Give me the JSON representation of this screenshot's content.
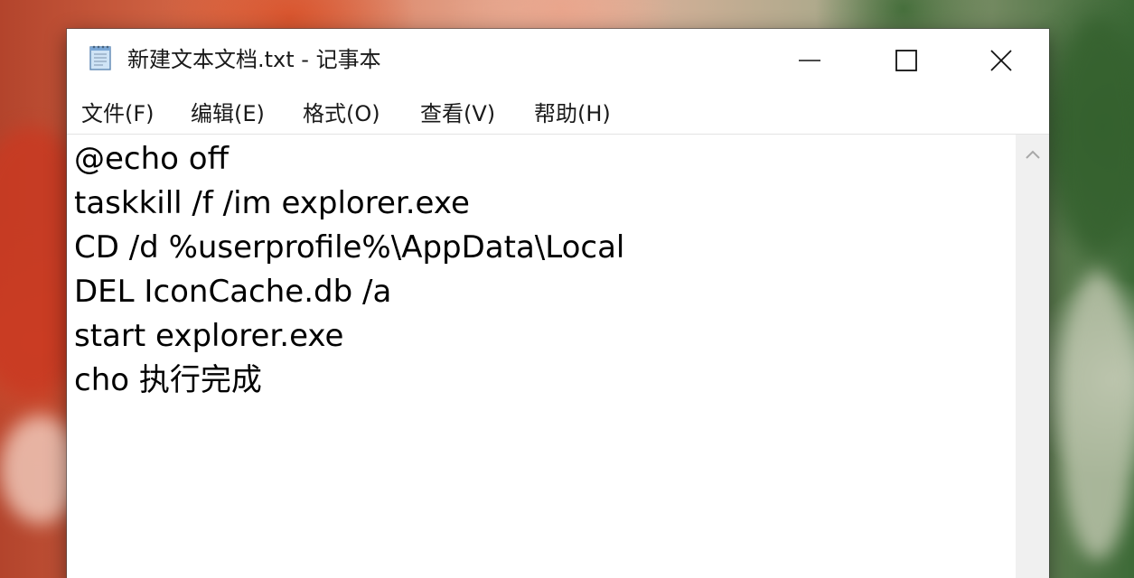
{
  "window": {
    "title": "新建文本文档.txt - 记事本",
    "controls": {
      "minimize_icon": "minimize-icon",
      "maximize_icon": "maximize-icon",
      "close_icon": "close-icon"
    }
  },
  "menu": {
    "items": [
      {
        "label": "文件(F)"
      },
      {
        "label": "编辑(E)"
      },
      {
        "label": "格式(O)"
      },
      {
        "label": "查看(V)"
      },
      {
        "label": "帮助(H)"
      }
    ]
  },
  "editor": {
    "lines": [
      "@echo off",
      "taskkill /f /im explorer.exe",
      "CD /d %userprofile%\\AppData\\Local",
      "DEL IconCache.db /a",
      "start explorer.exe",
      "cho 执行完成"
    ]
  },
  "colors": {
    "window_bg": "#ffffff",
    "text": "#000000",
    "scrollbar_bg": "#f0f0f0"
  }
}
